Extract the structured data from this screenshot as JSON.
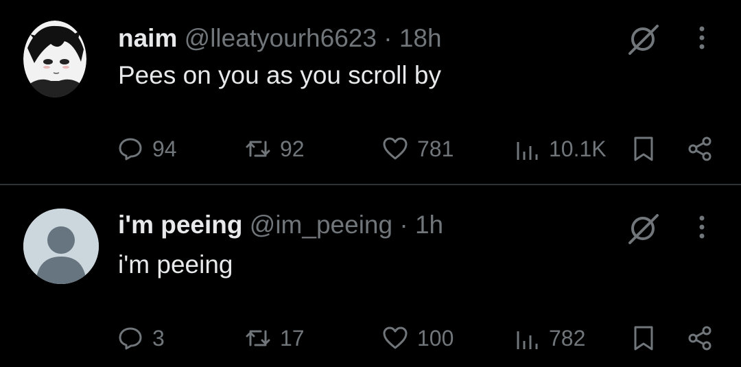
{
  "posts": [
    {
      "name": "naim",
      "handle": "@lleatyourh6623",
      "separator": "·",
      "time": "18h",
      "text": "Pees on you as you scroll by",
      "avatar_icon": "anime-avatar",
      "stats": {
        "replies": "94",
        "reposts": "92",
        "likes": "781",
        "views": "10.1K"
      }
    },
    {
      "name": "i'm peeing",
      "handle": "@im_peeing",
      "separator": "·",
      "time": "1h",
      "text": "i'm peeing",
      "avatar_icon": "default-profile-avatar",
      "stats": {
        "replies": "3",
        "reposts": "17",
        "likes": "100",
        "views": "782"
      }
    }
  ],
  "icons": {
    "grok": "grok-icon",
    "more": "more-options-icon",
    "reply": "reply-icon",
    "repost": "repost-icon",
    "like": "heart-icon",
    "views": "views-chart-icon",
    "bookmark": "bookmark-icon",
    "share": "share-icon"
  },
  "colors": {
    "background": "#000000",
    "primary_text": "#e7e9ea",
    "secondary_text": "#71767b",
    "divider": "#2f3336"
  }
}
